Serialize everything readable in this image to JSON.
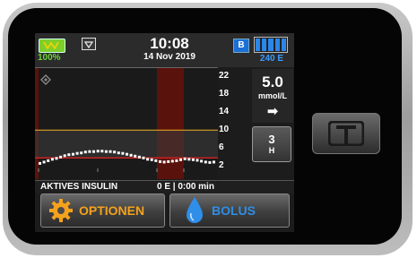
{
  "status_bar": {
    "battery_percent": "100%",
    "time": "10:08",
    "date": "14 Nov 2019",
    "bolus_badge": "B",
    "insulin_units": "240 E",
    "insulin_level_fraction": 1.0
  },
  "graph": {
    "y_ticks": [
      "22",
      "18",
      "14",
      "10",
      "6",
      "2"
    ],
    "y_range": [
      2,
      22
    ],
    "target_range": {
      "low": 3.9,
      "high": 10
    },
    "readings": [
      2.7,
      3.0,
      3.3,
      3.6,
      3.8,
      4.1,
      4.4,
      4.6,
      4.7,
      4.9,
      5.0,
      5.2,
      5.3,
      5.3,
      5.4,
      5.4,
      5.3,
      5.3,
      5.2,
      5.0,
      4.9,
      4.7,
      4.5,
      4.3,
      4.1,
      3.9,
      3.6,
      3.5,
      3.3,
      3.1,
      3.0,
      3.1,
      3.2,
      3.3,
      3.5,
      3.7,
      3.6,
      3.5,
      3.4,
      3.2,
      3.0,
      2.9,
      3.0
    ],
    "colors": {
      "target_low": "#cc2020",
      "target_high": "#f0b020",
      "event_band": "#5a120c",
      "points": "#ffffff"
    }
  },
  "bg_panel": {
    "value": "5.0",
    "unit": "mmol/L",
    "trend_arrow": "➡"
  },
  "hours_button": {
    "value": "3",
    "unit": "H"
  },
  "iob": {
    "label": "AKTIVES INSULIN",
    "value": "0 E | 0:00 min"
  },
  "buttons": {
    "options_label": "OPTIONEN",
    "options_icon": "gear-icon",
    "options_color": "#f4a21d",
    "bolus_label": "BOLUS",
    "bolus_icon": "drop-icon",
    "bolus_color": "#2f8ee8"
  }
}
